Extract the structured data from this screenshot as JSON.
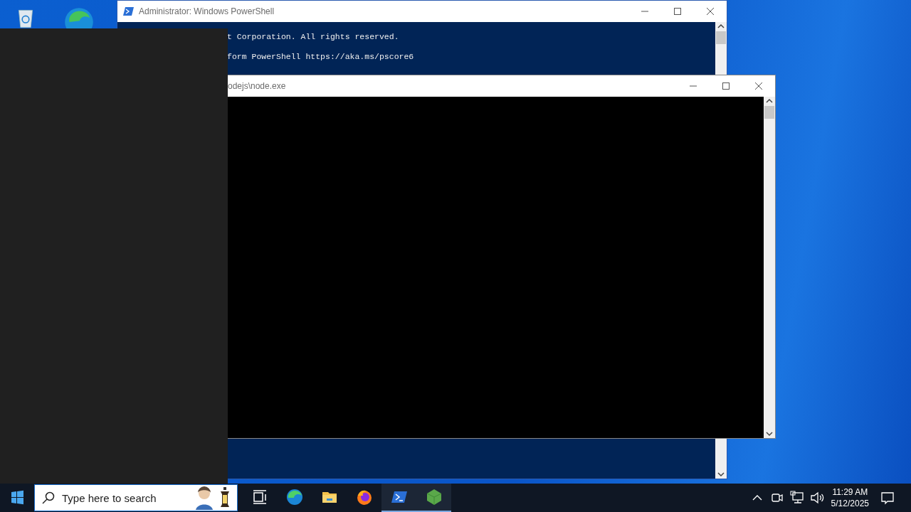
{
  "windows": [
    {
      "kind": "powershell",
      "title": "Administrator: Windows PowerShell",
      "lines": [
        "t Corporation. All rights reserved.",
        "form PowerShell https://aka.ms/pscore6"
      ]
    },
    {
      "kind": "console",
      "title": "odejs\\node.exe"
    }
  ],
  "taskbar": {
    "search": {
      "placeholder": "Type here to search"
    },
    "apps": [
      {
        "kind": "task-view",
        "running": false
      },
      {
        "kind": "edge",
        "running": false
      },
      {
        "kind": "folder",
        "running": false
      },
      {
        "kind": "firefox",
        "running": false
      },
      {
        "kind": "terminal",
        "running": true
      },
      {
        "kind": "cube",
        "running": true
      }
    ],
    "clock": {
      "time": "11:29 AM",
      "date": "5/12/2025"
    }
  }
}
